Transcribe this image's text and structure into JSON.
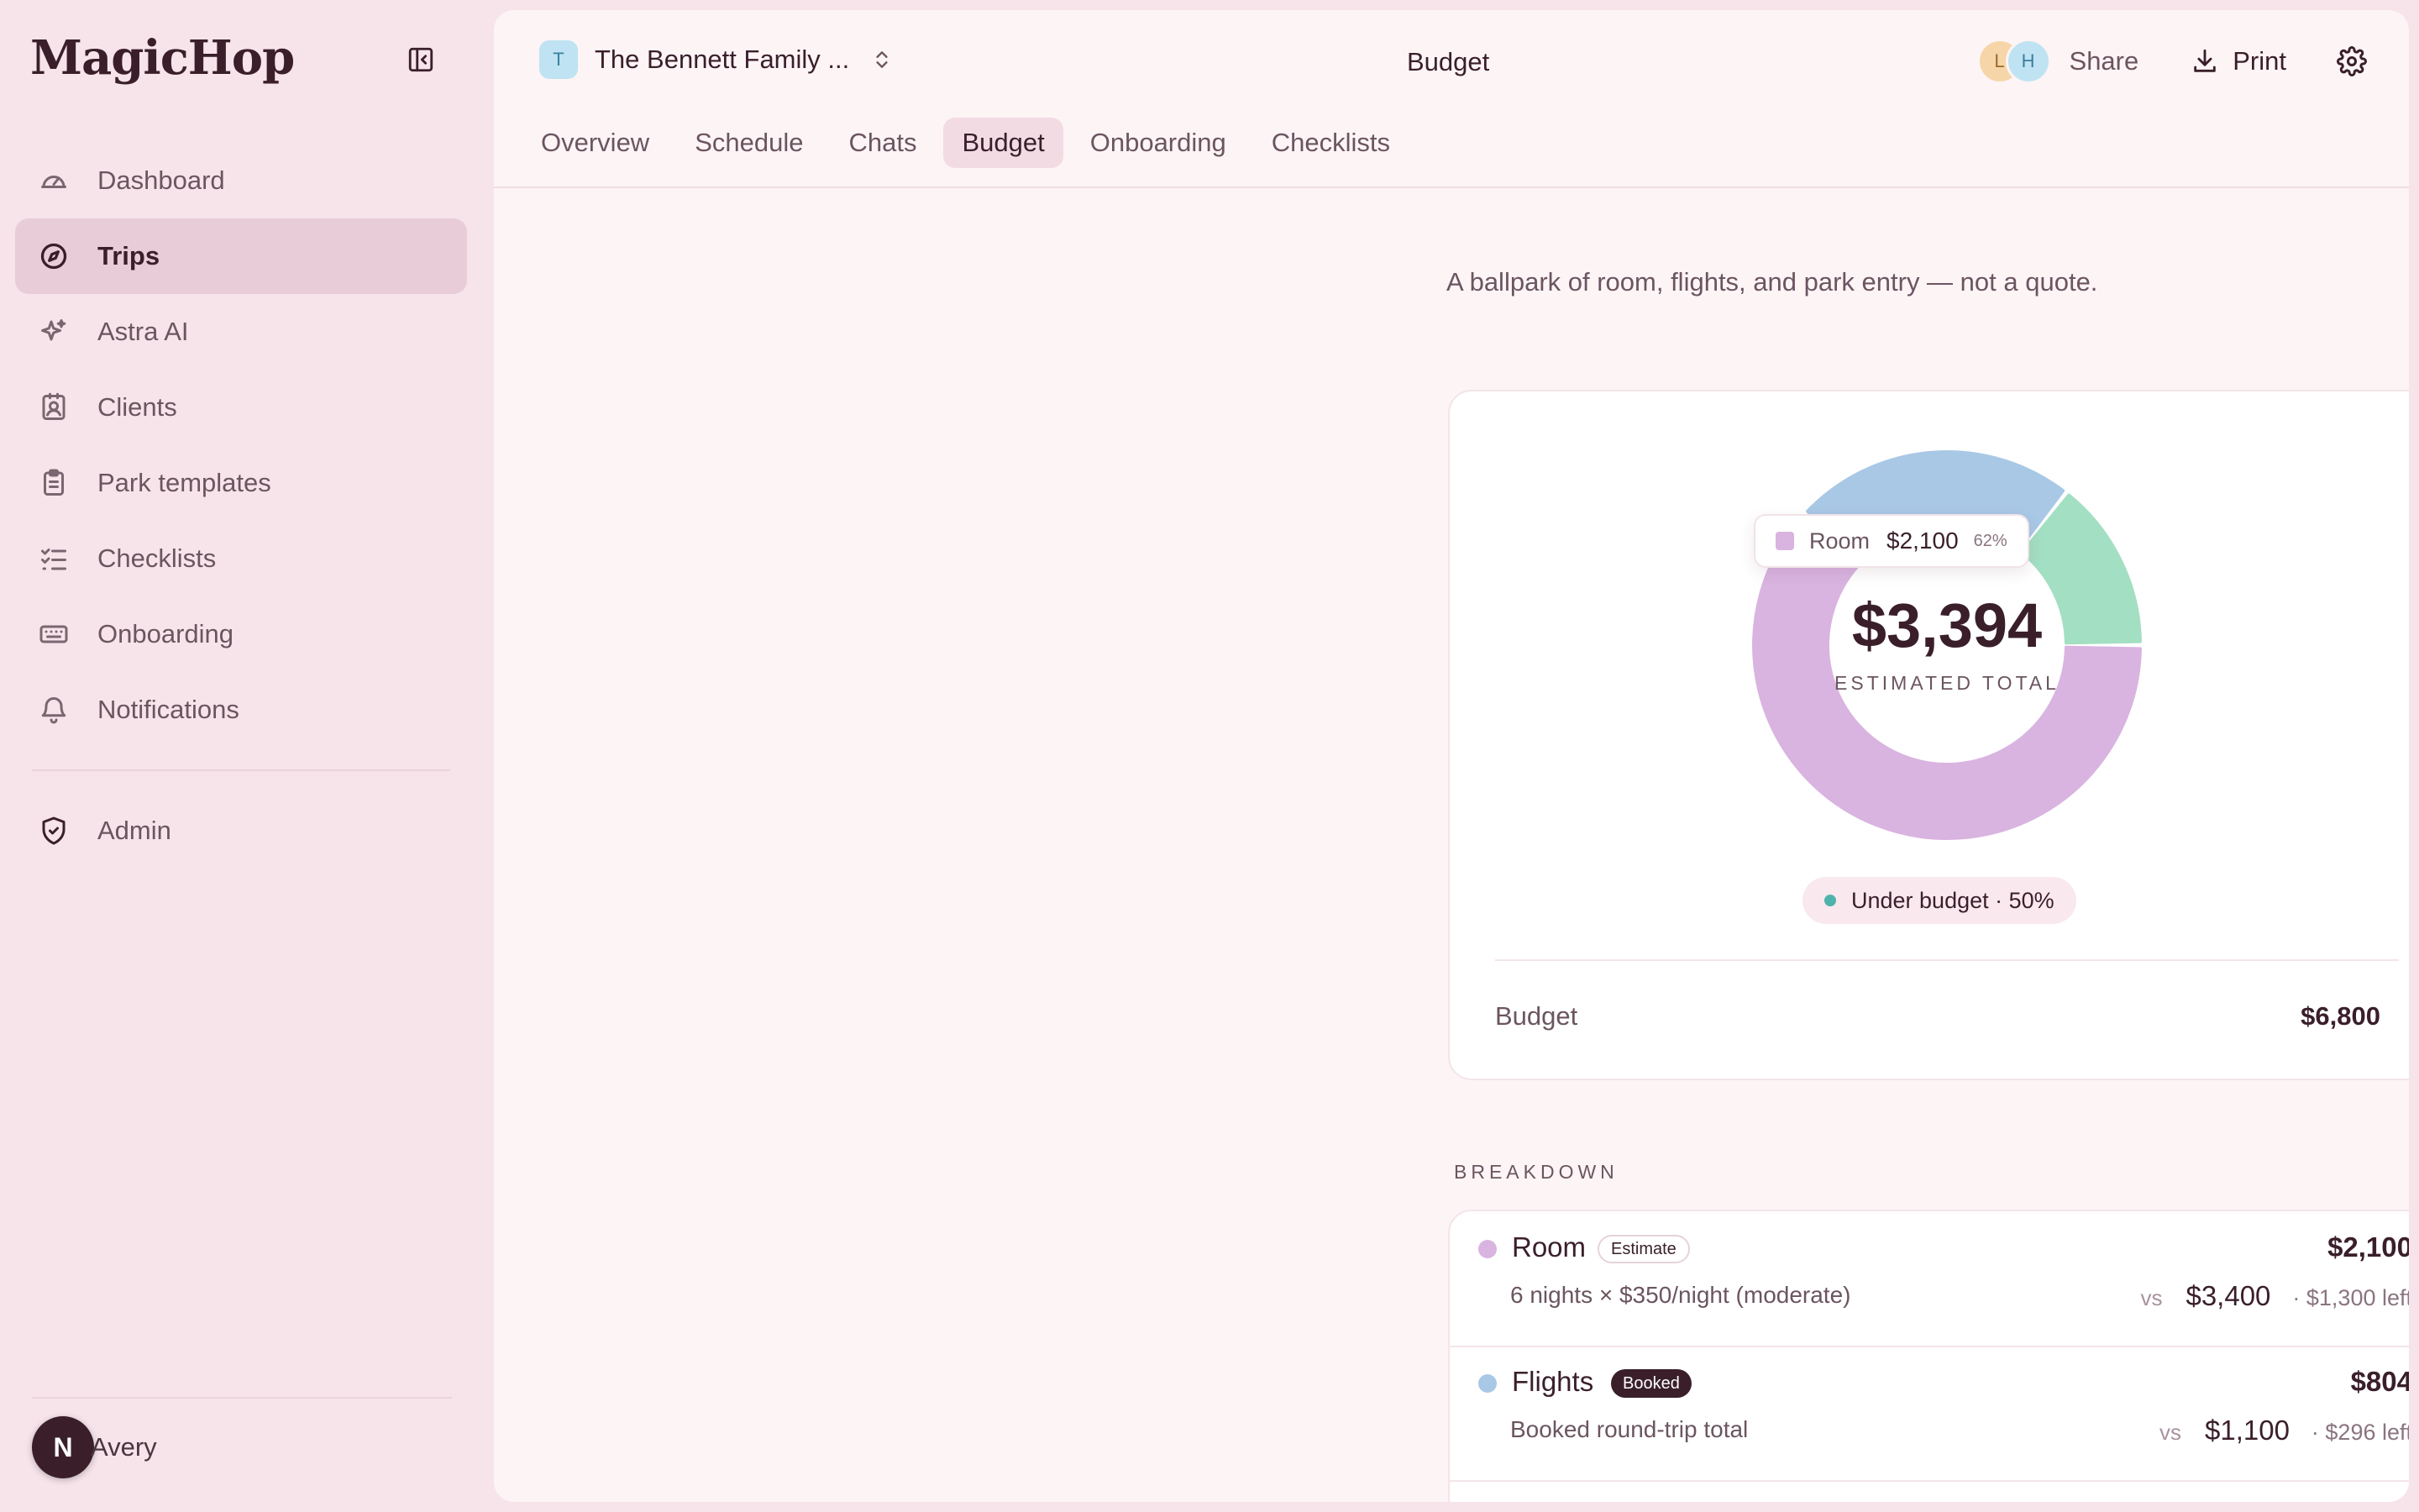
{
  "app": {
    "logo": "MagicHop"
  },
  "sidebar": {
    "items": [
      {
        "label": "Dashboard",
        "icon": "gauge-icon"
      },
      {
        "label": "Trips",
        "icon": "compass-icon",
        "active": true
      },
      {
        "label": "Astra AI",
        "icon": "sparkles-icon"
      },
      {
        "label": "Clients",
        "icon": "contact-card-icon"
      },
      {
        "label": "Park templates",
        "icon": "clipboard-icon"
      },
      {
        "label": "Checklists",
        "icon": "list-checks-icon"
      },
      {
        "label": "Onboarding",
        "icon": "keyboard-icon"
      },
      {
        "label": "Notifications",
        "icon": "bell-icon"
      }
    ],
    "admin": {
      "label": "Admin",
      "icon": "shield-check-icon"
    },
    "user": {
      "initial": "N",
      "name": "Avery"
    }
  },
  "header": {
    "trip_badge": "T",
    "trip_name": "The Bennett Family ...",
    "page_title": "Budget",
    "collaborators": [
      "L",
      "H"
    ],
    "share_label": "Share",
    "print_label": "Print"
  },
  "tabs": [
    {
      "label": "Overview"
    },
    {
      "label": "Schedule"
    },
    {
      "label": "Chats"
    },
    {
      "label": "Budget",
      "active": true
    },
    {
      "label": "Onboarding"
    },
    {
      "label": "Checklists"
    }
  ],
  "budget": {
    "subtitle": "A ballpark of room, flights, and park entry — not a quote.",
    "total": "$3,394",
    "total_label": "ESTIMATED TOTAL",
    "tooltip": {
      "name": "Room",
      "value": "$2,100",
      "pct": "62%"
    },
    "status": "Under budget · 50%",
    "budget_label": "Budget",
    "budget_value": "$6,800",
    "section_label": "BREAKDOWN",
    "colors": {
      "room": "#d9b4e0",
      "flights": "#a9c8e6",
      "park": "#a3dfc2",
      "status": "#4fb3ac"
    }
  },
  "chart_data": {
    "type": "pie",
    "donut": true,
    "categories": [
      "Room",
      "Flights",
      "Park entry"
    ],
    "values": [
      2100,
      804,
      490
    ],
    "colors": [
      "#d9b4e0",
      "#a9c8e6",
      "#a3dfc2"
    ]
  },
  "breakdown": [
    {
      "name": "Room",
      "tag": "Estimate",
      "amount": "$2,100",
      "desc": "6 nights × $350/night (moderate)",
      "vs": "vs",
      "target": "$3,400",
      "left": "· $1,300 left"
    },
    {
      "name": "Flights",
      "tag": "Booked",
      "amount": "$804",
      "desc": "Booked round-trip total",
      "vs": "vs",
      "target": "$1,100",
      "left": "· $296 left"
    }
  ]
}
